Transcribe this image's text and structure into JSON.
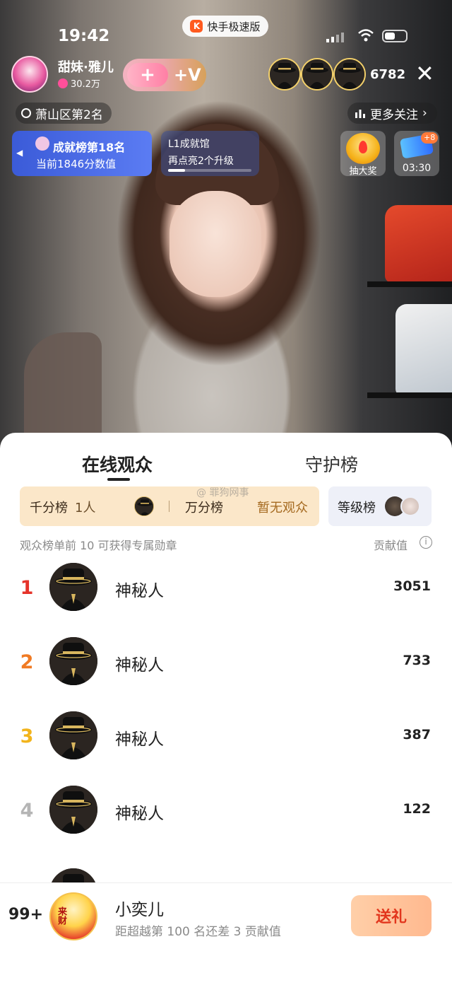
{
  "status_bar": {
    "time": "19:42",
    "app_name": "快手极速版"
  },
  "host": {
    "name": "甜妹·雅儿",
    "fans": "30.2万"
  },
  "follow": {
    "plus_label": "+",
    "v_label": "+V"
  },
  "viewers": {
    "count": "6782"
  },
  "chips": {
    "district_rank": "萧山区第2名",
    "more_follow": "更多关注"
  },
  "achievement": {
    "title": "成就榜第18名",
    "subtitle": "当前1846分数值"
  },
  "level_card": {
    "title": "L1成就馆",
    "subtitle": "再点亮2个升级",
    "progress": 0.2
  },
  "widgets": {
    "lottery_label": "抽大奖",
    "timer_label": "03:30",
    "timer_badge": "+8"
  },
  "sheet": {
    "tabs": [
      "在线观众",
      "守护榜"
    ],
    "thousand_board": "千分榜",
    "thousand_count": "1人",
    "ten_thousand_board": "万分榜",
    "ten_thousand_status": "暂无观众",
    "level_board": "等级榜",
    "watermark": "@ 罪狗网事",
    "hint": "观众榜单前 10 可获得专属勋章",
    "contribution_label": "贡献值",
    "info_icon": "i"
  },
  "audience": [
    {
      "rank": "1",
      "name": "神秘人",
      "score": "3051",
      "rank_color": "#e5332a"
    },
    {
      "rank": "2",
      "name": "神秘人",
      "score": "733",
      "rank_color": "#f07a23"
    },
    {
      "rank": "3",
      "name": "神秘人",
      "score": "387",
      "rank_color": "#f2b41c"
    },
    {
      "rank": "4",
      "name": "神秘人",
      "score": "122",
      "rank_color": "#b5b5b5"
    }
  ],
  "me": {
    "rank": "99+",
    "name": "小奕儿",
    "sub": "距超越第 100 名还差 3 贡献值",
    "avatar_text": "来财"
  },
  "gift_button": "送礼"
}
